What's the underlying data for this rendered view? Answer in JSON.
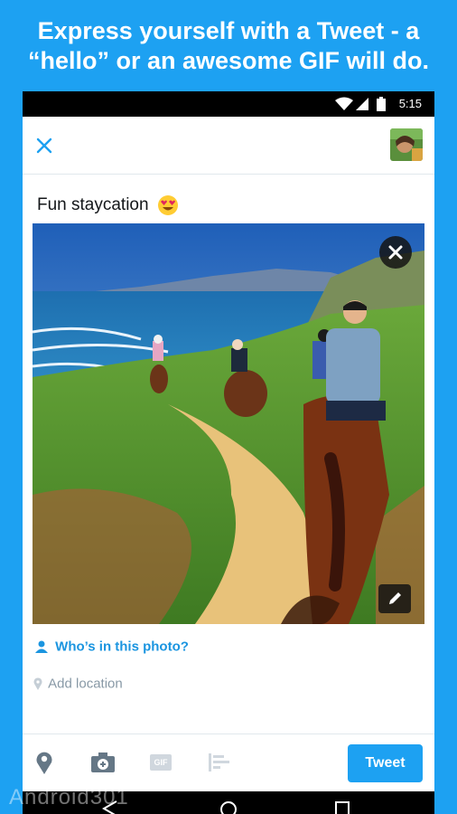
{
  "promo": {
    "line1": "Express yourself with a Tweet - a",
    "line2": "“hello” or an awesome GIF will do."
  },
  "status_bar": {
    "time": "5:15"
  },
  "compose": {
    "text": "Fun staycation",
    "emoji": "heart-eyes-emoji",
    "tag_people": "Who’s in this photo?",
    "location_placeholder": "Add location"
  },
  "toolbar": {
    "gif_label": "GIF",
    "tweet_label": "Tweet"
  },
  "watermark": "Android301",
  "colors": {
    "brand": "#1da1f2",
    "link": "#1b95e0",
    "muted": "#8899a6"
  },
  "icons": [
    "close-icon",
    "wifi-icon",
    "signal-icon",
    "battery-icon",
    "remove-photo-icon",
    "edit-icon",
    "person-icon",
    "location-pin-icon",
    "camera-icon",
    "gif-icon",
    "poll-icon",
    "back-icon",
    "home-icon",
    "recents-icon"
  ]
}
